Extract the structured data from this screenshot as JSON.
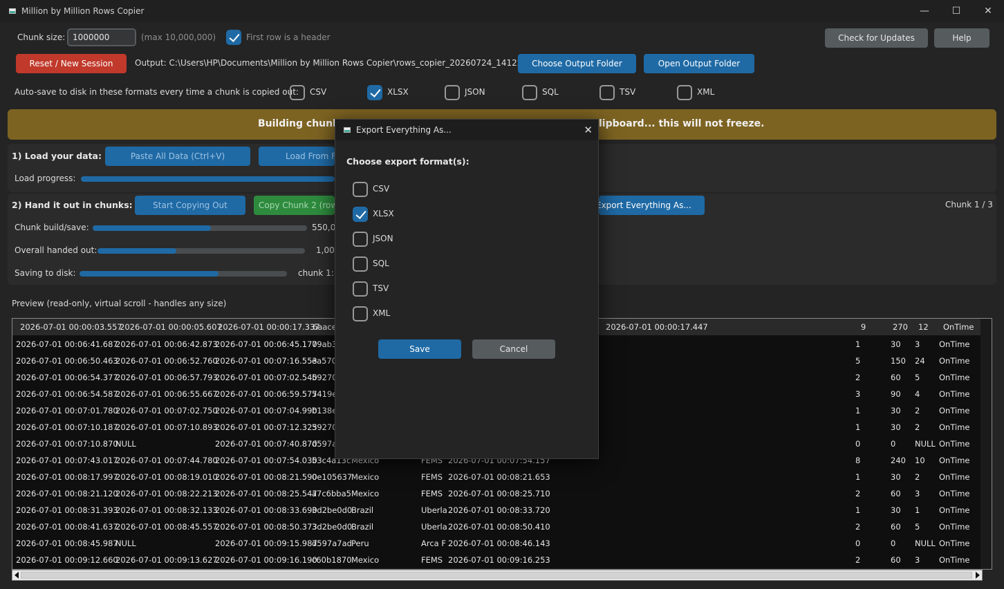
{
  "window": {
    "title": "Million by Million Rows Copier",
    "minimize": "—",
    "maximize": "☐",
    "close": "✕"
  },
  "top": {
    "chunk_size_label": "Chunk size:",
    "chunk_size_value": "1000000",
    "chunk_max": "(max 10,000,000)",
    "header_checkbox_label": "First row is a header",
    "check_updates": "Check for Updates",
    "help": "Help"
  },
  "session": {
    "reset": "Reset / New Session",
    "output_path": "Output: C:\\Users\\HP\\Documents\\Million by Million Rows Copier\\rows_copier_20260724_141220",
    "choose_folder": "Choose Output Folder",
    "open_folder": "Open Output Folder"
  },
  "autosave": {
    "label": "Auto-save to disk in these formats every time a chunk is copied out:",
    "formats": [
      {
        "name": "CSV",
        "checked": false
      },
      {
        "name": "XLSX",
        "checked": true
      },
      {
        "name": "JSON",
        "checked": false
      },
      {
        "name": "SQL",
        "checked": false
      },
      {
        "name": "TSV",
        "checked": false
      },
      {
        "name": "XML",
        "checked": false
      }
    ]
  },
  "banner": {
    "left": "Building chunk 2",
    "right": "lipboard... this will not freeze."
  },
  "load": {
    "label": "1) Load your data:",
    "paste": "Paste All Data (Ctrl+V)",
    "load_from": "Load From F",
    "progress_label": "Load progress:",
    "progress": 1.0
  },
  "hand": {
    "label": "2) Hand it out in chunks:",
    "start": "Start Copying Out",
    "copy_chunk": "Copy Chunk 2 (rows",
    "export": "Export Everything As...",
    "chunk_counter": "Chunk 1 / 3"
  },
  "progress": {
    "build_label": "Chunk build/save:",
    "build_value": 0.55,
    "build_text": "550,00",
    "overall_label": "Overall handed out:",
    "overall_value": 0.38,
    "overall_text": "1,000",
    "saving_label": "Saving to disk:",
    "saving_value": 0.67,
    "saving_text": "chunk 1: "
  },
  "preview": {
    "label": "Preview (read-only, virtual scroll - handles any size)",
    "header": [
      "2026-07-01 00:00:03.557",
      "2026-07-01 00:00:05.607",
      "2026-07-01 00:00:17.337",
      "6aace",
      "",
      "",
      "2026-07-01 00:00:17.447",
      "9",
      "270",
      "12",
      "OnTime"
    ],
    "rows": [
      [
        "2026-07-01 00:06:41.687",
        "2026-07-01 00:06:42.873",
        "2026-07-01 00:06:45.170",
        "79ab3",
        "",
        "",
        "",
        "1",
        "30",
        "3",
        "OnTime"
      ],
      [
        "2026-07-01 00:06:50.463",
        "2026-07-01 00:06:52.760",
        "2026-07-01 00:07:16.553",
        "ea570",
        "",
        "",
        "",
        "5",
        "150",
        "24",
        "OnTime"
      ],
      [
        "2026-07-01 00:06:54.377",
        "2026-07-01 00:06:57.793",
        "2026-07-01 00:07:02.540",
        "59270",
        "",
        "",
        "",
        "2",
        "60",
        "5",
        "OnTime"
      ],
      [
        "2026-07-01 00:06:54.587",
        "2026-07-01 00:06:55.667",
        "2026-07-01 00:06:59.577",
        "5419e",
        "",
        "",
        "",
        "3",
        "90",
        "4",
        "OnTime"
      ],
      [
        "2026-07-01 00:07:01.780",
        "2026-07-01 00:07:02.750",
        "2026-07-01 00:07:04.990",
        "b138e",
        "",
        "",
        "",
        "1",
        "30",
        "2",
        "OnTime"
      ],
      [
        "2026-07-01 00:07:10.187",
        "2026-07-01 00:07:10.893",
        "2026-07-01 00:07:12.323",
        "59270",
        "",
        "",
        "",
        "1",
        "30",
        "2",
        "OnTime"
      ],
      [
        "2026-07-01 00:07:10.870",
        "NULL",
        "2026-07-01 00:07:40.870",
        "d597a",
        "",
        "",
        "",
        "0",
        "0",
        "NULL",
        "OnTime"
      ],
      [
        "2026-07-01 00:07:43.017",
        "2026-07-01 00:07:44.780",
        "2026-07-01 00:07:54.030",
        "53c4a13c",
        "Mexico",
        "FEMS",
        "2026-07-01 00:07:54.157",
        "8",
        "240",
        "10",
        "OnTime"
      ],
      [
        "2026-07-01 00:08:17.997",
        "2026-07-01 00:08:19.010",
        "2026-07-01 00:08:21.590",
        "0e105637",
        "Mexico",
        "FEMS",
        "2026-07-01 00:08:21.653",
        "1",
        "30",
        "2",
        "OnTime"
      ],
      [
        "2026-07-01 00:08:21.120",
        "2026-07-01 00:08:22.213",
        "2026-07-01 00:08:25.547",
        "a7c6bba5",
        "Mexico",
        "FEMS",
        "2026-07-01 00:08:25.710",
        "2",
        "60",
        "3",
        "OnTime"
      ],
      [
        "2026-07-01 00:08:31.393",
        "2026-07-01 00:08:32.133",
        "2026-07-01 00:08:33.690",
        "3d2be0d0",
        "Brazil",
        "Uberla",
        "2026-07-01 00:08:33.720",
        "1",
        "30",
        "1",
        "OnTime"
      ],
      [
        "2026-07-01 00:08:41.637",
        "2026-07-01 00:08:45.557",
        "2026-07-01 00:08:50.373",
        "3d2be0d0",
        "Brazil",
        "Uberla",
        "2026-07-01 00:08:50.410",
        "2",
        "60",
        "5",
        "OnTime"
      ],
      [
        "2026-07-01 00:08:45.987",
        "NULL",
        "2026-07-01 00:09:15.987",
        "d597a7ad",
        "Peru",
        "Arca F",
        "2026-07-01 00:08:46.143",
        "0",
        "0",
        "NULL",
        "OnTime"
      ],
      [
        "2026-07-01 00:09:12.660",
        "2026-07-01 00:09:13.627",
        "2026-07-01 00:09:16.190",
        "c60b1870",
        "Mexico",
        "FEMS",
        "2026-07-01 00:09:16.253",
        "2",
        "60",
        "3",
        "OnTime"
      ]
    ]
  },
  "dialog": {
    "title": "Export Everything As...",
    "heading": "Choose export format(s):",
    "options": [
      {
        "name": "CSV",
        "checked": false
      },
      {
        "name": "XLSX",
        "checked": true
      },
      {
        "name": "JSON",
        "checked": false
      },
      {
        "name": "SQL",
        "checked": false
      },
      {
        "name": "TSV",
        "checked": false
      },
      {
        "name": "XML",
        "checked": false
      }
    ],
    "save": "Save",
    "cancel": "Cancel",
    "close": "✕"
  },
  "colors": {
    "accent": "#1f6aa5",
    "banner": "#7d6322",
    "danger": "#c0392b",
    "success": "#2e8b3e"
  }
}
